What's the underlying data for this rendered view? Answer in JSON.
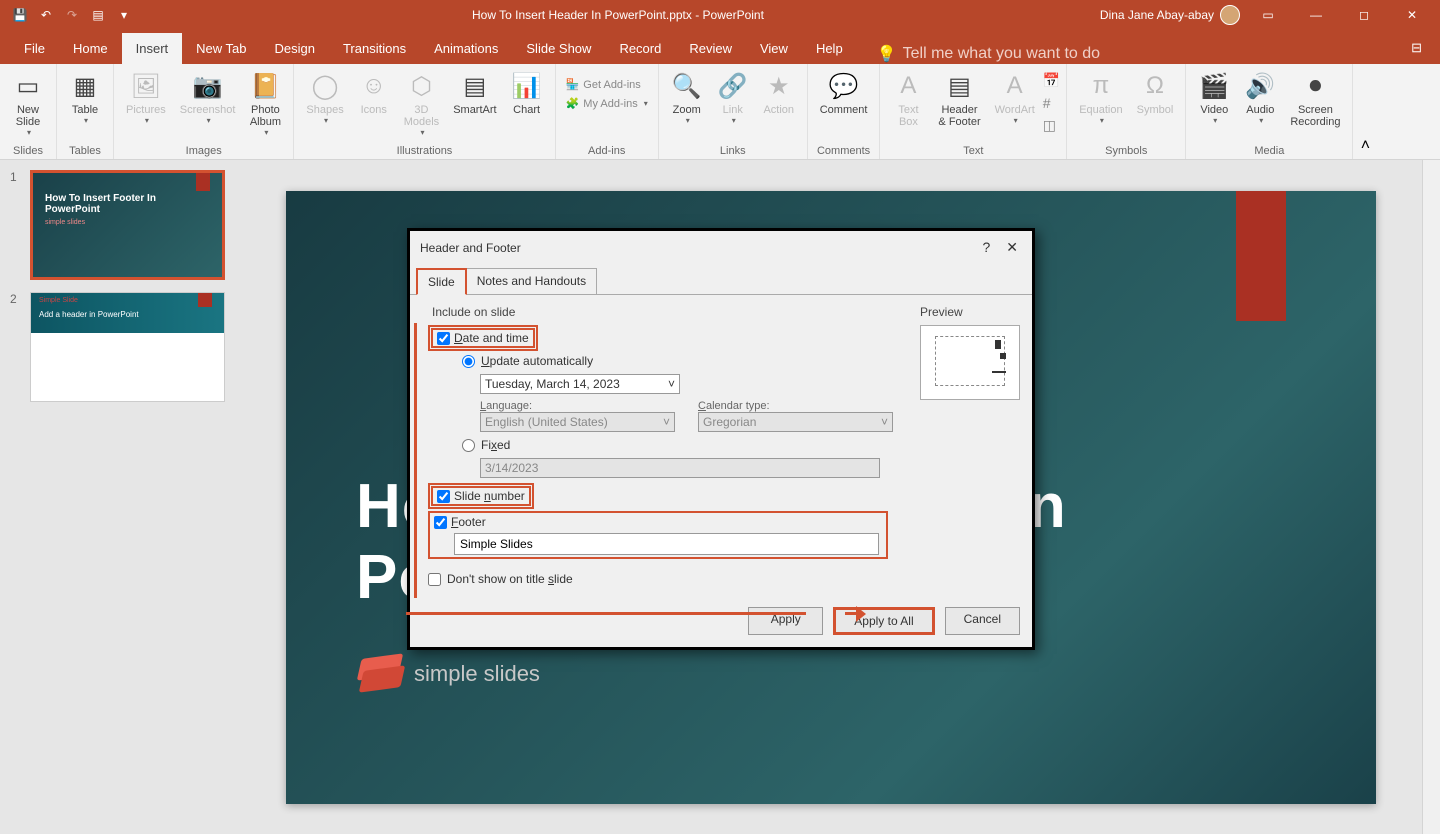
{
  "titlebar": {
    "doc_title": "How To Insert Header In PowerPoint.pptx  -  PowerPoint",
    "user_name": "Dina Jane Abay-abay"
  },
  "menu": {
    "file": "File",
    "home": "Home",
    "insert": "Insert",
    "newtab": "New Tab",
    "design": "Design",
    "transitions": "Transitions",
    "animations": "Animations",
    "slideshow": "Slide Show",
    "record": "Record",
    "review": "Review",
    "view": "View",
    "help": "Help",
    "tellme": "Tell me what you want to do"
  },
  "ribbon": {
    "newslide": "New\nSlide",
    "slides_group": "Slides",
    "table": "Table",
    "tables_group": "Tables",
    "pictures": "Pictures",
    "screenshot": "Screenshot",
    "photoalbum": "Photo\nAlbum",
    "images_group": "Images",
    "shapes": "Shapes",
    "icons": "Icons",
    "models3d": "3D\nModels",
    "smartart": "SmartArt",
    "chart": "Chart",
    "illustrations_group": "Illustrations",
    "getaddins": "Get Add-ins",
    "myaddins": "My Add-ins",
    "addins_group": "Add-ins",
    "zoom": "Zoom",
    "link": "Link",
    "action": "Action",
    "links_group": "Links",
    "comment": "Comment",
    "comments_group": "Comments",
    "textbox": "Text\nBox",
    "headerfooter": "Header\n& Footer",
    "wordart": "WordArt",
    "text_group": "Text",
    "equation": "Equation",
    "symbol": "Symbol",
    "symbols_group": "Symbols",
    "video": "Video",
    "audio": "Audio",
    "screenrec": "Screen\nRecording",
    "media_group": "Media"
  },
  "thumbs": {
    "n1": "1",
    "n2": "2",
    "t1": "How To Insert Footer In PowerPoint",
    "t1sub": "simple slides",
    "t2label": "Simple Slide",
    "t2text": "Add a header in PowerPoint"
  },
  "slide": {
    "title_line1": "How To Insert Footer In",
    "title_line2": "PowerPoint",
    "logo_text": "simple slides"
  },
  "dialog": {
    "title": "Header and Footer",
    "tab_slide": "Slide",
    "tab_notes": "Notes and Handouts",
    "include_label": "Include on slide",
    "preview_label": "Preview",
    "date_time": "Date and time",
    "update_auto": "Update automatically",
    "date_value": "Tuesday, March 14, 2023",
    "language_label": "Language:",
    "language_value": "English (United States)",
    "calendar_label": "Calendar type:",
    "calendar_value": "Gregorian",
    "fixed": "Fixed",
    "fixed_value": "3/14/2023",
    "slide_number": "Slide number",
    "footer": "Footer",
    "footer_value": "Simple Slides",
    "dont_show": "Don't show on title slide",
    "apply": "Apply",
    "apply_all": "Apply to All",
    "cancel": "Cancel"
  }
}
